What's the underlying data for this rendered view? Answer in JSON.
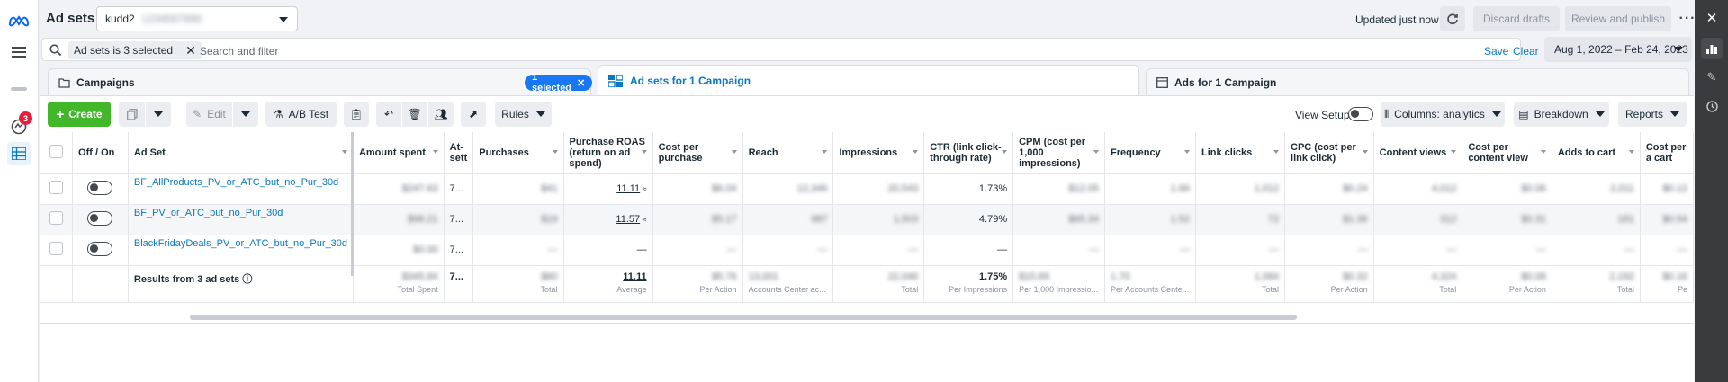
{
  "app": {
    "title": "Ad sets",
    "account_name": "kudd2",
    "account_suffix": "1234567890",
    "updated_text": "Updated just now",
    "discard_label": "Discard drafts",
    "review_label": "Review and publish",
    "notifications_count": "3"
  },
  "filter": {
    "chip_label": "Ad sets is 3 selected",
    "placeholder": "Search and filter",
    "save_label": "Save",
    "clear_label": "Clear",
    "date_range": "Aug 1, 2022 – Feb 24, 2023"
  },
  "tabs": {
    "campaigns": "Campaigns",
    "selected_pill": "1 selected",
    "adsets": "Ad sets for 1 Campaign",
    "ads": "Ads for 1 Campaign"
  },
  "toolbar": {
    "create": "Create",
    "edit": "Edit",
    "ab_test": "A/B Test",
    "rules": "Rules",
    "view_setup": "View Setup",
    "columns": "Columns: analytics",
    "breakdown": "Breakdown",
    "reports": "Reports"
  },
  "columns": {
    "off_on": "Off / On",
    "ad_set": "Ad Set",
    "amount_spent": "Amount spent",
    "attribution": "At- sett",
    "purchases": "Purchases",
    "roas": "Purchase ROAS (return on ad spend)",
    "cost_per_purchase": "Cost per purchase",
    "reach": "Reach",
    "impressions": "Impressions",
    "ctr": "CTR (link click-through rate)",
    "cpm": "CPM (cost per 1,000 impressions)",
    "frequency": "Frequency",
    "link_clicks": "Link clicks",
    "cpc": "CPC (cost per link click)",
    "content_views": "Content views",
    "cost_per_content_view": "Cost per content view",
    "adds_to_cart": "Adds to cart",
    "cost_per_atc": "Cost per a cart"
  },
  "rows": [
    {
      "name": "BF_AllProducts_PV_or_ATC_but_no_Pur_30d",
      "attribution": "7...",
      "roas": "11.11",
      "ctr": "1.73%",
      "blur": [
        "$247.63",
        "$41",
        "$6.04",
        "12,346",
        "20,543",
        "$12.05",
        "1.66",
        "1,012",
        "$0.24",
        "4,012",
        "$0.06",
        "2,011",
        "$0.12"
      ]
    },
    {
      "name": "BF_PV_or_ATC_but_no_Pur_30d",
      "attribution": "7...",
      "roas": "11.57",
      "ctr": "4.79%",
      "blur": [
        "$98.21",
        "$19",
        "$5.17",
        "987",
        "1,503",
        "$65.34",
        "1.52",
        "72",
        "$1.36",
        "312",
        "$0.31",
        "181",
        "$0.54"
      ]
    },
    {
      "name": "BlackFridayDeals_PV_or_ATC_but_no_Pur_30d",
      "attribution": "7...",
      "roas": "—",
      "ctr": "—",
      "blur": [
        "$0.00",
        "—",
        "—",
        "—",
        "—",
        "—",
        "—",
        "—",
        "—",
        "—",
        "—",
        "—",
        "—"
      ]
    }
  ],
  "summary": {
    "label": "Results from 3 ad sets",
    "attribution": "7...",
    "roas": "11.11",
    "roas_sub": "Average",
    "ctr": "1.75%",
    "ctr_sub": "Per Impressions",
    "blur": [
      "$345.84",
      "$60",
      "$5.76",
      "13,001",
      "22,046",
      "$15.69",
      "1.70",
      "1,084",
      "$0.32",
      "4,324",
      "$0.08",
      "2,192",
      "$0.16"
    ],
    "subs": {
      "amount_spent": "Total Spent",
      "purchases": "Total",
      "cost_per_purchase": "Per Action",
      "reach": "Accounts Center ac...",
      "impressions": "Total",
      "cpm": "Per 1,000 Impressio...",
      "frequency": "Per Accounts Cente...",
      "link_clicks": "Total",
      "cpc": "Per Action",
      "content_views": "Total",
      "cost_per_content_view": "Per Action",
      "adds_to_cart": "Total",
      "cost_per_atc": "Pe"
    }
  }
}
